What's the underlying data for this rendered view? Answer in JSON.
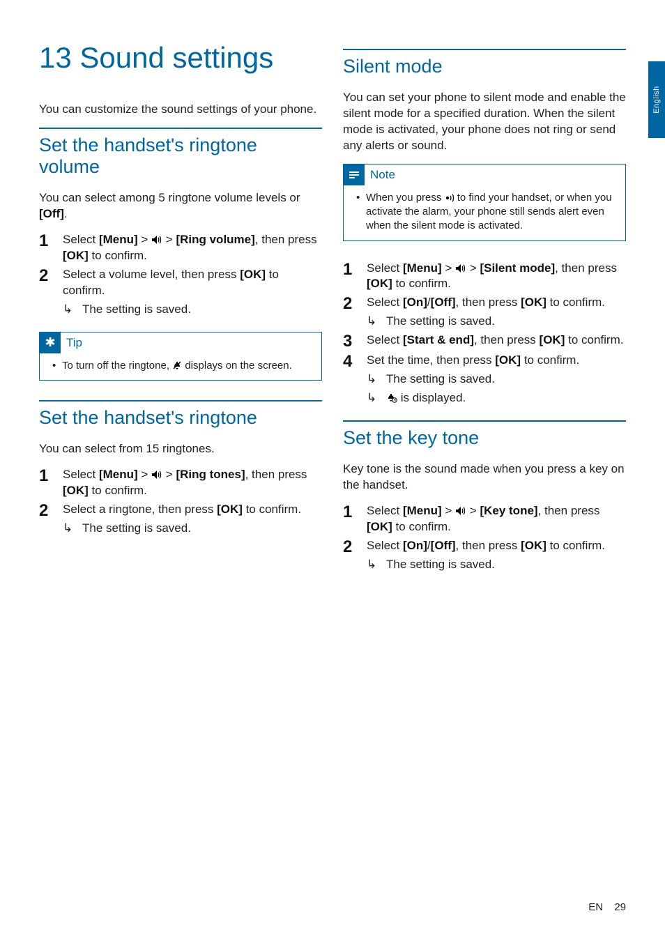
{
  "side_tab": "English",
  "footer": {
    "lang": "EN",
    "page": "29"
  },
  "chapter_title": "13 Sound settings",
  "intro": "You can customize the sound settings of your phone.",
  "left": {
    "volume": {
      "heading": "Set the handset's ringtone volume",
      "intro_a": "You can select among 5 ringtone volume levels or ",
      "intro_off": "[Off]",
      "intro_b": ".",
      "s1_a": "Select ",
      "s1_menu": "[Menu]",
      "s1_gt1": " > ",
      "s1_gt2": " > ",
      "s1_ringvol": "[Ring volume]",
      "s1_b": ", then press ",
      "s1_ok": "[OK]",
      "s1_c": " to confirm.",
      "s2_a": "Select a volume level, then press ",
      "s2_ok": "[OK]",
      "s2_b": " to confirm.",
      "result": "The setting is saved."
    },
    "tip": {
      "label": "Tip",
      "text_a": "To turn off the ringtone, ",
      "text_b": " displays on the screen."
    },
    "ringtone": {
      "heading": "Set the handset's ringtone",
      "intro": "You can select from 15 ringtones.",
      "s1_a": "Select ",
      "s1_menu": "[Menu]",
      "s1_gt1": " > ",
      "s1_gt2": " > ",
      "s1_ringtones": "[Ring tones]",
      "s1_b": ", then press ",
      "s1_ok": "[OK]",
      "s1_c": " to confirm.",
      "s2_a": "Select a ringtone, then press ",
      "s2_ok": "[OK]",
      "s2_b": " to confirm.",
      "result": "The setting is saved."
    }
  },
  "right": {
    "silent": {
      "heading": "Silent mode",
      "intro": "You can set your phone to silent mode and enable the silent mode for a specified duration. When the silent mode is activated, your phone does not ring or send any alerts or sound.",
      "note_label": "Note",
      "note_a": "When you press ",
      "note_b": " to find your handset, or when you activate the alarm, your phone still sends alert even when the silent mode is activated.",
      "s1_a": "Select ",
      "s1_menu": "[Menu]",
      "s1_gt1": " > ",
      "s1_gt2": " > ",
      "s1_silent": "[Silent mode]",
      "s1_b": ", then press ",
      "s1_ok": "[OK]",
      "s1_c": " to confirm.",
      "s2_a": "Select ",
      "s2_on": "[On]",
      "s2_slash": "/",
      "s2_off": "[Off]",
      "s2_b": ", then press ",
      "s2_ok": "[OK]",
      "s2_c": " to confirm.",
      "s2_result": "The setting is saved.",
      "s3_a": "Select ",
      "s3_se": "[Start & end]",
      "s3_b": ", then press ",
      "s3_ok": "[OK]",
      "s3_c": " to confirm.",
      "s4_a": "Set the time, then press ",
      "s4_ok": "[OK]",
      "s4_b": " to confirm.",
      "s4_result1": "The setting is saved.",
      "s4_result2_b": " is displayed."
    },
    "keytone": {
      "heading": "Set the key tone",
      "intro": "Key tone is the sound made when you press a key on the handset.",
      "s1_a": "Select ",
      "s1_menu": "[Menu]",
      "s1_gt1": " > ",
      "s1_gt2": " > ",
      "s1_kt": "[Key tone]",
      "s1_b": ", then press ",
      "s1_ok": "[OK]",
      "s1_c": " to confirm.",
      "s2_a": "Select ",
      "s2_on": "[On]",
      "s2_slash": "/",
      "s2_off": "[Off]",
      "s2_b": ", then press ",
      "s2_ok": "[OK]",
      "s2_c": " to confirm.",
      "result": "The setting is saved."
    }
  }
}
